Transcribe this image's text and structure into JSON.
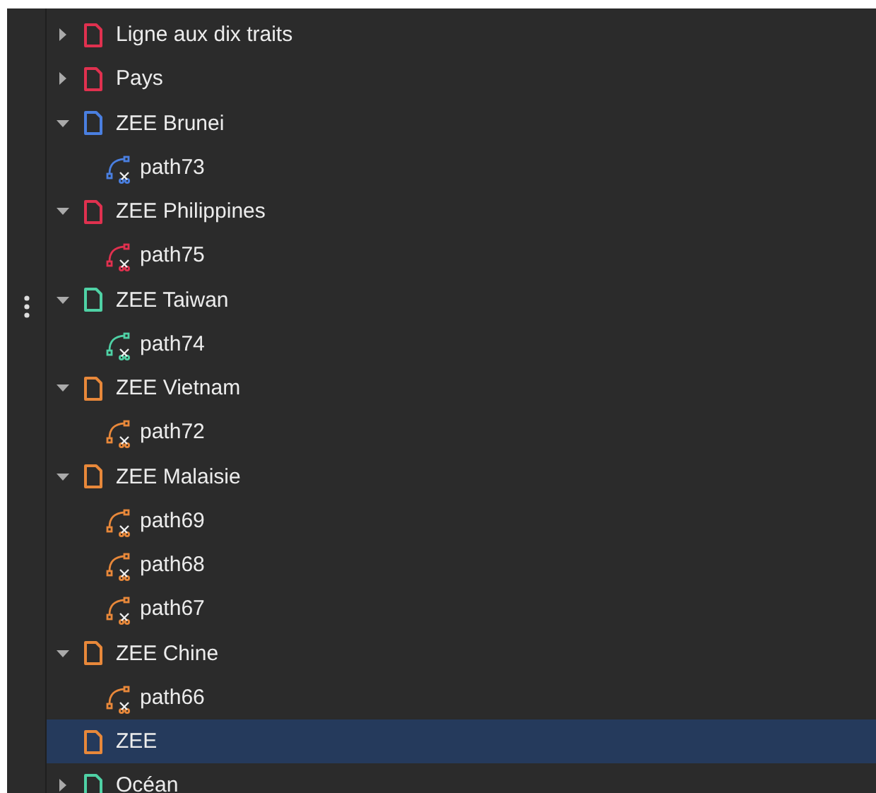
{
  "layers": [
    {
      "kind": "layer",
      "label": "Ligne aux dix traits",
      "color": "#e0314f",
      "expanded": false,
      "selected": false
    },
    {
      "kind": "layer",
      "label": "Pays",
      "color": "#e0314f",
      "expanded": false,
      "selected": false
    },
    {
      "kind": "layer",
      "label": "ZEE Brunei",
      "color": "#4a7fe0",
      "expanded": true,
      "selected": false,
      "children": [
        {
          "kind": "path",
          "label": "path73",
          "selected": false
        }
      ]
    },
    {
      "kind": "layer",
      "label": "ZEE Philippines",
      "color": "#e0314f",
      "expanded": true,
      "selected": false,
      "children": [
        {
          "kind": "path",
          "label": "path75",
          "selected": false
        }
      ]
    },
    {
      "kind": "layer",
      "label": "ZEE Taiwan",
      "color": "#4fd1a5",
      "expanded": true,
      "selected": false,
      "children": [
        {
          "kind": "path",
          "label": "path74",
          "selected": false
        }
      ]
    },
    {
      "kind": "layer",
      "label": "ZEE Vietnam",
      "color": "#e8883a",
      "expanded": true,
      "selected": false,
      "children": [
        {
          "kind": "path",
          "label": "path72",
          "selected": false
        }
      ]
    },
    {
      "kind": "layer",
      "label": "ZEE Malaisie",
      "color": "#e8883a",
      "expanded": true,
      "selected": false,
      "children": [
        {
          "kind": "path",
          "label": "path69",
          "selected": false
        },
        {
          "kind": "path",
          "label": "path68",
          "selected": false
        },
        {
          "kind": "path",
          "label": "path67",
          "selected": false
        }
      ]
    },
    {
      "kind": "layer",
      "label": "ZEE Chine",
      "color": "#e8883a",
      "expanded": true,
      "selected": false,
      "children": [
        {
          "kind": "path",
          "label": "path66",
          "selected": false
        }
      ]
    },
    {
      "kind": "layer",
      "label": "ZEE",
      "color": "#e8883a",
      "selected": true
    },
    {
      "kind": "layer",
      "label": "Océan",
      "color": "#4fd1a5",
      "expanded": false,
      "selected": false
    }
  ]
}
